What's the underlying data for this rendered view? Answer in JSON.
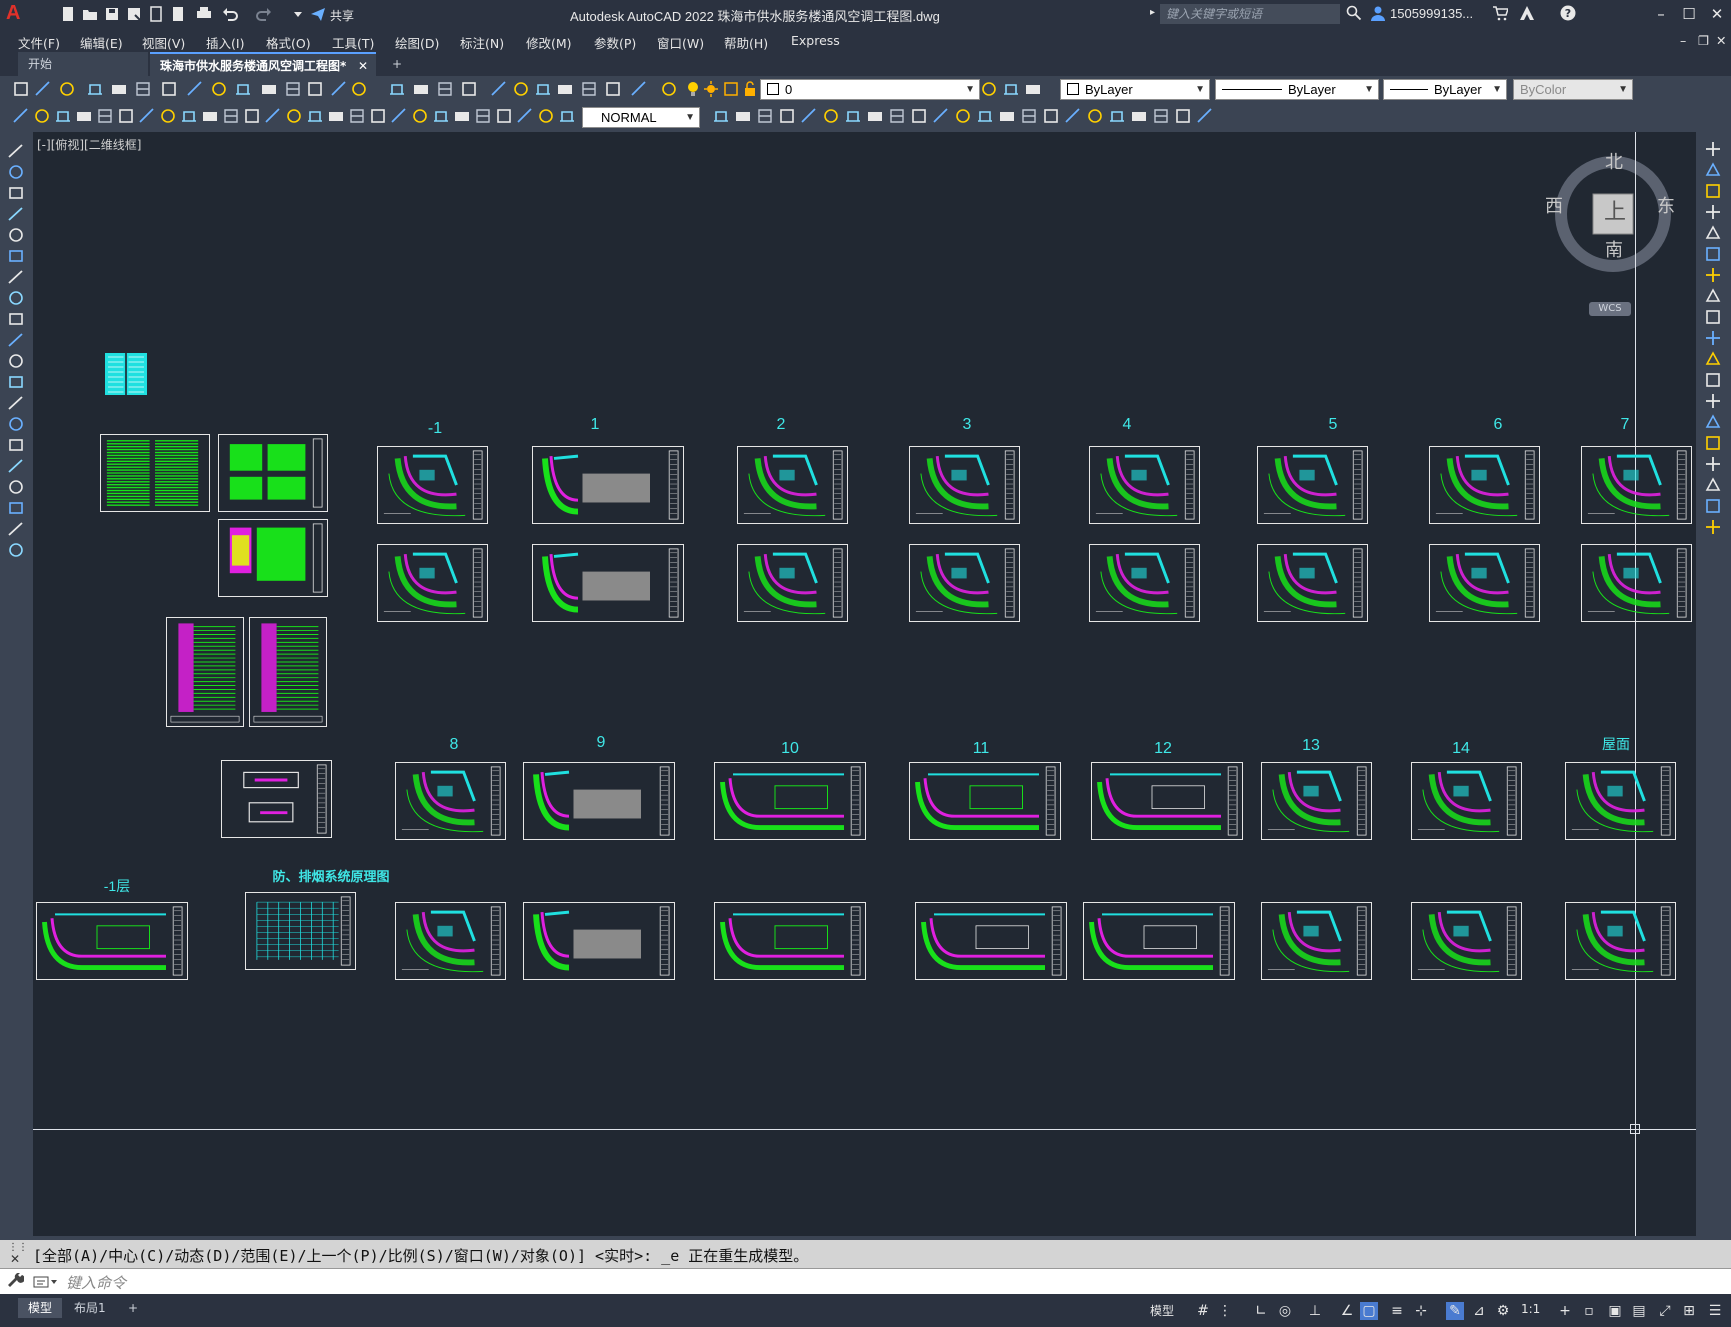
{
  "app": {
    "logo": "A",
    "title": "Autodesk AutoCAD 2022    珠海市供水服务楼通风空调工程图.dwg",
    "share_label": "共享",
    "search_placeholder": "键入关键字或短语",
    "user": "1505999135..."
  },
  "menu": [
    "文件(F)",
    "编辑(E)",
    "视图(V)",
    "插入(I)",
    "格式(O)",
    "工具(T)",
    "绘图(D)",
    "标注(N)",
    "修改(M)",
    "参数(P)",
    "窗口(W)",
    "帮助(H)",
    "Express"
  ],
  "tabs": {
    "start": "开始",
    "active": "珠海市供水服务楼通风空调工程图*",
    "close": "✕",
    "add": "+"
  },
  "toolbar": {
    "layer_value": "0",
    "color_value": "ByLayer",
    "linetype_value": "ByLayer",
    "lineweight_value": "ByLayer",
    "plotstyle_value": "ByColor",
    "dimstyle_value": "NORMAL"
  },
  "viewport": {
    "label": "[-][俯视][二维线框]",
    "viewcube": {
      "north": "北",
      "south": "南",
      "east": "东",
      "west": "西",
      "face": "上",
      "wcs": "WCS"
    }
  },
  "drawing": {
    "level_labels": {
      "m1": "-1",
      "l1": "1",
      "l2": "2",
      "l3": "3",
      "l4": "4",
      "l5": "5",
      "l6": "6",
      "l7": "7",
      "l8": "8",
      "l9": "9",
      "l10": "10",
      "l11": "11",
      "l12": "12",
      "l13": "13",
      "l14": "14",
      "roof": "屋面",
      "m1floor": "-1层",
      "smoke": "防、排烟系统原理图"
    }
  },
  "command": {
    "history": "[全部(A)/中心(C)/动态(D)/范围(E)/上一个(P)/比例(S)/窗口(W)/对象(O)] <实时>: _e 正在重生成模型。",
    "input_placeholder": "键入命令"
  },
  "status": {
    "model_tab": "模型",
    "layout_tab": "布局1",
    "add_tab": "+",
    "model_button": "模型",
    "scale": "1:1"
  },
  "colors": {
    "canvas": "#212832",
    "chrome": "#2b3240",
    "toolbar": "#3b4453",
    "label_cyan": "#3fe7e7",
    "cad_green": "#18e01a",
    "cad_magenta": "#e020e0",
    "cad_cyan": "#20e0e0"
  }
}
